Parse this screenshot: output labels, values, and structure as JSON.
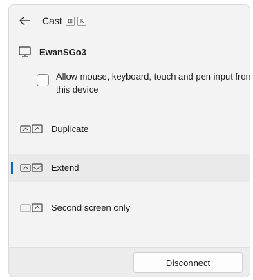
{
  "header": {
    "back_icon": "back-arrow-icon",
    "title": "Cast",
    "shortcut_keys": [
      "⊞",
      "K"
    ]
  },
  "device": {
    "icon": "monitor-icon",
    "name": "EwanSGo3"
  },
  "input_option": {
    "label": "Allow mouse, keyboard, touch and pen input from this device",
    "checked": false
  },
  "projection_modes": [
    {
      "label": "Duplicate",
      "icon": "duplicate-display-icon",
      "selected": false
    },
    {
      "label": "Extend",
      "icon": "extend-display-icon",
      "selected": true
    },
    {
      "label": "Second screen only",
      "icon": "second-screen-only-icon",
      "selected": false
    }
  ],
  "footer": {
    "disconnect_label": "Disconnect"
  },
  "colors": {
    "accent": "#0067c0",
    "panel_bg": "#f3f3f3"
  }
}
